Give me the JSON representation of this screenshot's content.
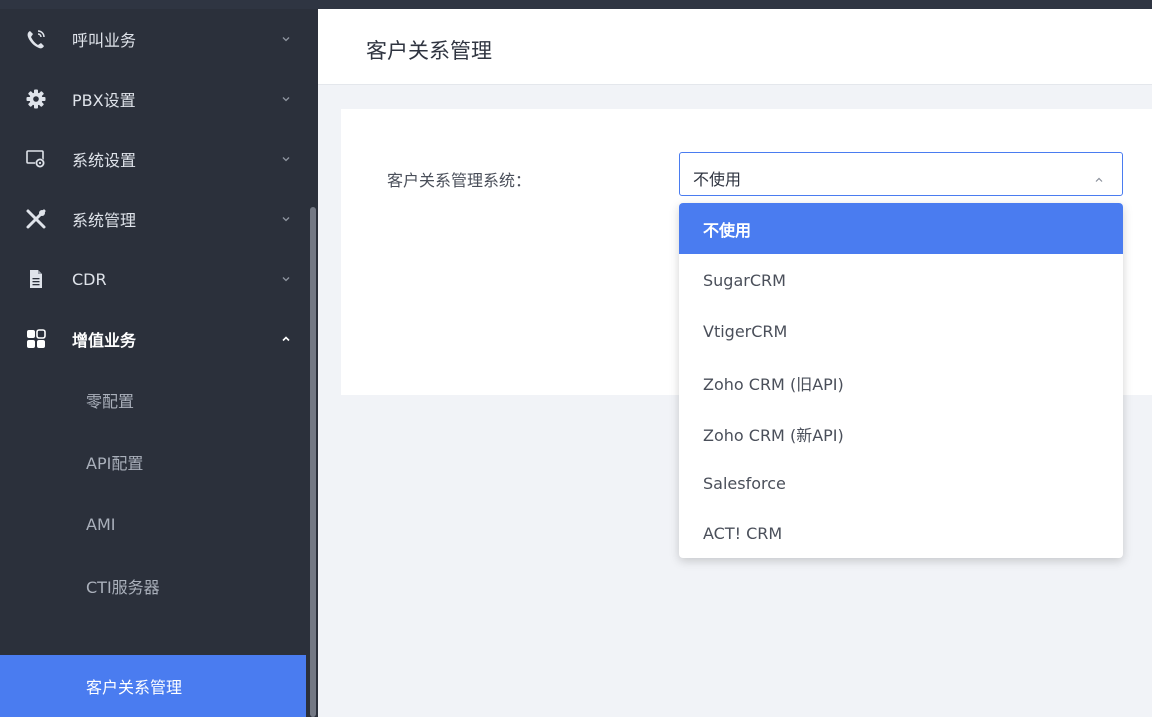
{
  "sidebar": {
    "items": [
      {
        "label": "呼叫业务",
        "icon": "phone-icon"
      },
      {
        "label": "PBX设置",
        "icon": "gear-icon"
      },
      {
        "label": "系统设置",
        "icon": "system-settings-icon"
      },
      {
        "label": "系统管理",
        "icon": "tools-icon"
      },
      {
        "label": "CDR",
        "icon": "document-icon"
      },
      {
        "label": "增值业务",
        "icon": "apps-icon"
      }
    ],
    "subitems": [
      {
        "label": "零配置"
      },
      {
        "label": "API配置"
      },
      {
        "label": "AMI"
      },
      {
        "label": "CTI服务器"
      },
      {
        "label": "客户关系管理"
      }
    ]
  },
  "header": {
    "title": "客户关系管理"
  },
  "form": {
    "crm_label": "客户关系管理系统：",
    "crm_value": "不使用",
    "options": [
      "不使用",
      "SugarCRM",
      "VtigerCRM",
      "Zoho CRM (旧API)",
      "Zoho CRM (新API)",
      "Salesforce",
      "ACT! CRM"
    ]
  },
  "colors": {
    "accent": "#4a7cf0",
    "sidebar_bg": "#2b303b"
  }
}
